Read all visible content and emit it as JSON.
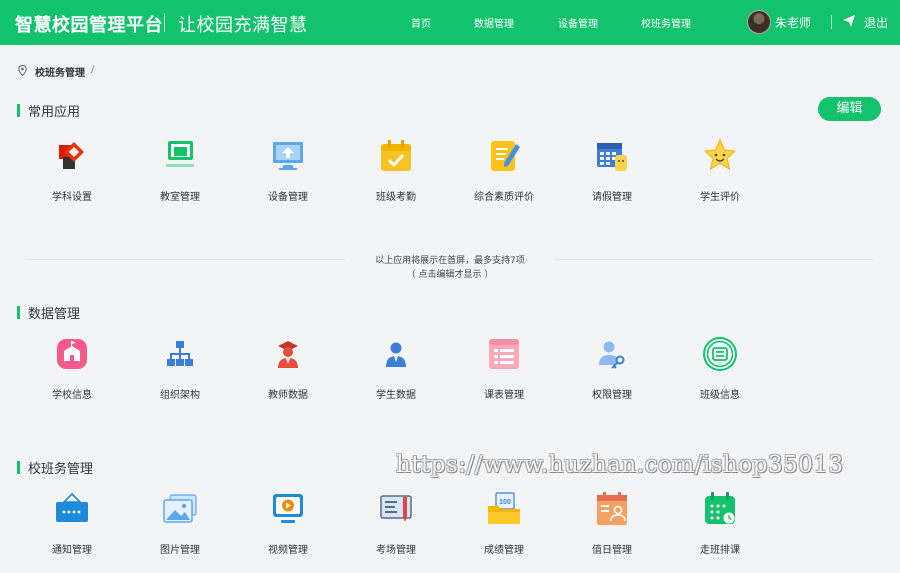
{
  "header": {
    "brand": "智慧校园管理平台",
    "slogan": "让校园充满智慧",
    "nav": [
      "首页",
      "数据管理",
      "设备管理",
      "校班务管理"
    ],
    "user_name": "朱老师",
    "logout": "退出",
    "bg_color": "#13c26c"
  },
  "breadcrumb": {
    "current": "校班务管理",
    "separator": "/"
  },
  "sections": {
    "common": {
      "title": "常用应用",
      "edit_label": "编辑",
      "items": [
        {
          "label": "学科设置",
          "icon": "subject-settings-icon"
        },
        {
          "label": "教室管理",
          "icon": "classroom-icon"
        },
        {
          "label": "设备管理",
          "icon": "device-upload-icon"
        },
        {
          "label": "班级考勤",
          "icon": "attendance-icon"
        },
        {
          "label": "综合素质评价",
          "icon": "quality-eval-icon"
        },
        {
          "label": "请假管理",
          "icon": "leave-icon"
        },
        {
          "label": "学生评价",
          "icon": "student-eval-icon"
        }
      ],
      "hint_line1": "以上应用将展示在首屏，最多支持7项",
      "hint_line2": "（ 点击编辑才显示 ）"
    },
    "data": {
      "title": "数据管理",
      "items": [
        {
          "label": "学校信息",
          "icon": "school-icon"
        },
        {
          "label": "组织架构",
          "icon": "org-chart-icon"
        },
        {
          "label": "教师数据",
          "icon": "teacher-icon"
        },
        {
          "label": "学生数据",
          "icon": "student-icon"
        },
        {
          "label": "课表管理",
          "icon": "timetable-icon"
        },
        {
          "label": "权限管理",
          "icon": "permission-icon"
        },
        {
          "label": "班级信息",
          "icon": "class-info-icon"
        }
      ]
    },
    "affairs": {
      "title": "校班务管理",
      "items": [
        {
          "label": "通知管理",
          "icon": "notice-icon"
        },
        {
          "label": "图片管理",
          "icon": "image-icon"
        },
        {
          "label": "视频管理",
          "icon": "video-icon"
        },
        {
          "label": "考场管理",
          "icon": "exam-room-icon"
        },
        {
          "label": "成绩管理",
          "icon": "grades-icon"
        },
        {
          "label": "值日管理",
          "icon": "duty-icon"
        },
        {
          "label": "走班排课",
          "icon": "course-schedule-icon"
        }
      ]
    }
  },
  "watermark": "https://www.huzhan.com/ishop35013"
}
